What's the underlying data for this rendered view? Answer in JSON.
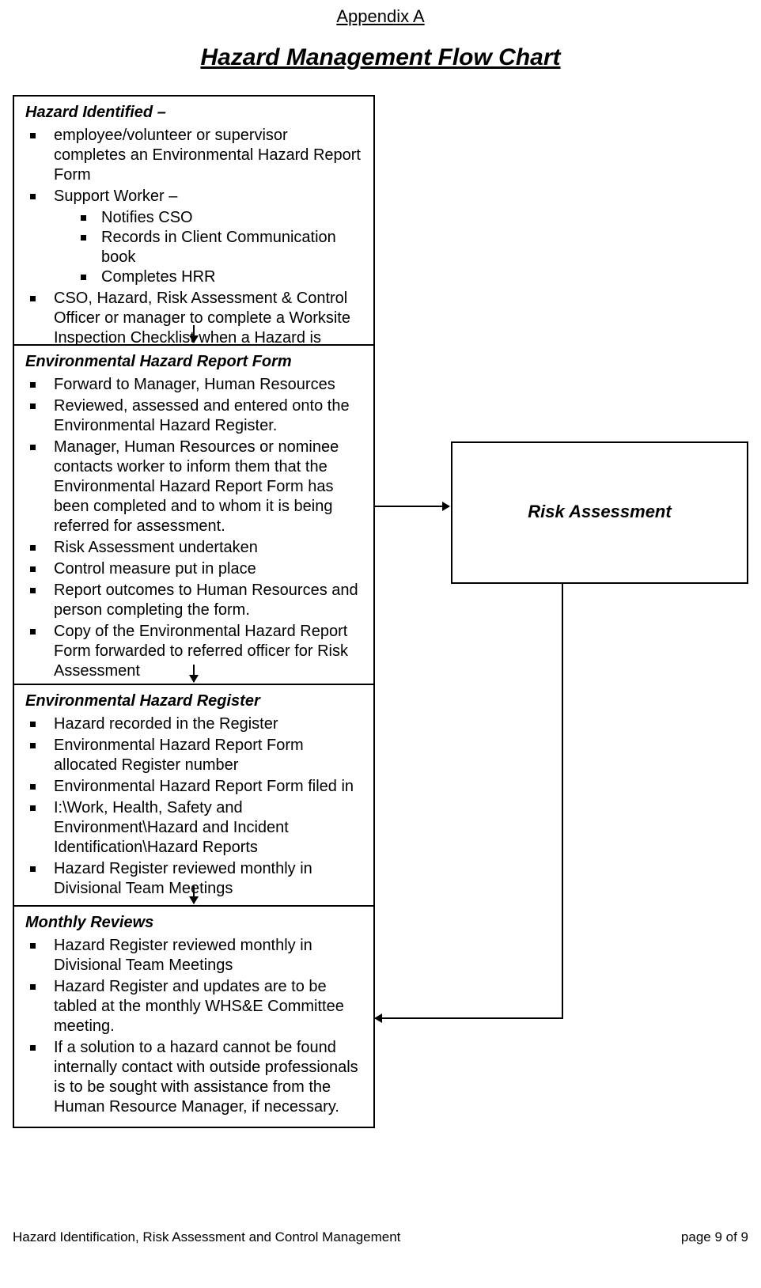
{
  "header": {
    "appendix": "Appendix A",
    "title": "Hazard Management Flow Chart"
  },
  "boxes": {
    "hazard_identified": {
      "title": "Hazard Identified –",
      "items": [
        "employee/volunteer or supervisor completes an Environmental Hazard Report Form",
        "Support Worker –",
        "CSO, Hazard, Risk Assessment & Control Officer or manager to complete a Worksite Inspection Checklist when a Hazard is identified."
      ],
      "support_worker_sub": [
        "Notifies CSO",
        "Records in Client Communication book",
        "Completes HRR"
      ]
    },
    "ehrf": {
      "title": "Environmental Hazard Report Form",
      "items": [
        "Forward to Manager, Human Resources",
        "Reviewed, assessed and entered  onto the Environmental Hazard Register.",
        "Manager, Human Resources or nominee contacts worker to inform them that the Environmental Hazard Report Form has been completed and to whom it is being referred for assessment.",
        "Risk Assessment undertaken",
        "Control measure put in place",
        "Report outcomes to Human Resources and person completing the form.",
        "Copy of the Environmental Hazard Report Form forwarded to referred officer for Risk Assessment"
      ]
    },
    "ehr": {
      "title": "Environmental Hazard Register",
      "items": [
        "Hazard recorded in the Register",
        "Environmental Hazard Report Form allocated Register number",
        "Environmental Hazard Report Form filed in",
        "I:\\Work, Health, Safety and Environment\\Hazard and Incident Identification\\Hazard Reports",
        "Hazard Register reviewed monthly in Divisional Team Meetings"
      ]
    },
    "monthly": {
      "title": "Monthly Reviews",
      "items": [
        "Hazard Register reviewed monthly in Divisional Team Meetings",
        "Hazard Register and updates are to be tabled at the monthly WHS&E Committee meeting.",
        "If a solution to a hazard cannot be found internally contact with outside professionals is to be sought with assistance from the Human Resource Manager, if necessary."
      ]
    },
    "risk": {
      "title": "Risk Assessment"
    }
  },
  "footer": {
    "left": "Hazard Identification, Risk Assessment and Control Management",
    "right": "page 9 of 9"
  }
}
